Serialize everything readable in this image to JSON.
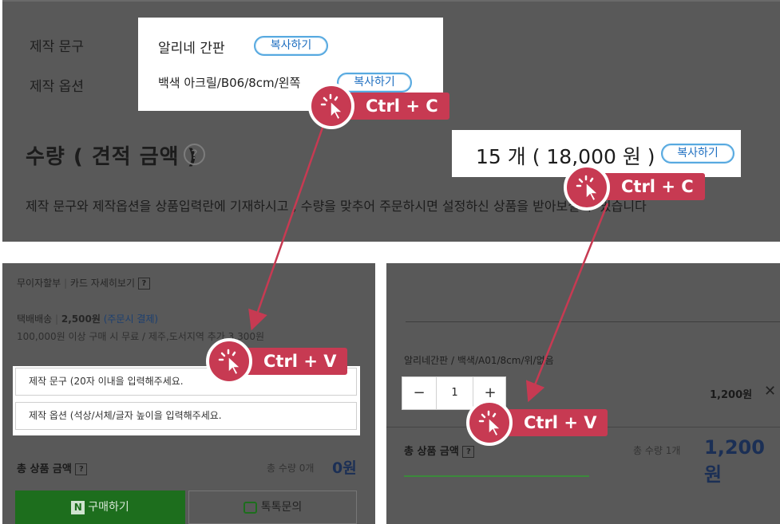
{
  "top": {
    "label_text": "제작 문구",
    "label_option": "제작 옵션",
    "copy_text_value": "알리네 간판",
    "copy_option_value": "백색 아크릴/B06/8cm/왼쪽",
    "copy_button": "복사하기",
    "qty_title": "수량 ( 견적 금액 )",
    "help_icon": "?",
    "price_value": "15 개 ( 18,000 원 )",
    "description": "제작 문구와 제작옵션을 상품입력란에 기재하시고 , 수량을 맞추어 주문하시면 설정하신 상품을 받아보실 수 있습니다"
  },
  "annotations": {
    "copy_badge_1": "Ctrl + C",
    "copy_badge_2": "Ctrl + C",
    "paste_badge_1": "Ctrl + V",
    "paste_badge_2": "Ctrl + V",
    "accent_color": "#c73a52",
    "icon": "click-cursor-icon"
  },
  "left_panel": {
    "installment": "무이자할부",
    "card_detail": "카드 자세히보기",
    "q": "?",
    "shipping_type": "택배배송",
    "shipping_price": "2,500원",
    "shipping_pay": "(주문시 결제)",
    "shipping_note": "100,000원 이상 구매 시 무료 / 제주,도서지역 추가 3,300원",
    "text_input_placeholder": "제작 문구 (20자 이내을 입력해주세요.",
    "option_input_placeholder": "제작 옵션 (석상/서체/글자 높이을 입력해주세요.",
    "total_label": "총 상품 금액",
    "total_qty": "총 수량 0개",
    "total_price": "0원",
    "buy_button": "구매하기",
    "buy_logo": "N",
    "talk_button": "톡톡문의"
  },
  "right_panel": {
    "option_summary": "알리네간판 / 백색/A01/8cm/위/없음",
    "stepper_minus": "−",
    "stepper_value": "1",
    "stepper_plus": "+",
    "item_price": "1,200원",
    "remove": "✕",
    "total_label": "총 상품 금액",
    "q": "?",
    "total_qty": "총 수량 1개",
    "total_price": "1,200원"
  }
}
